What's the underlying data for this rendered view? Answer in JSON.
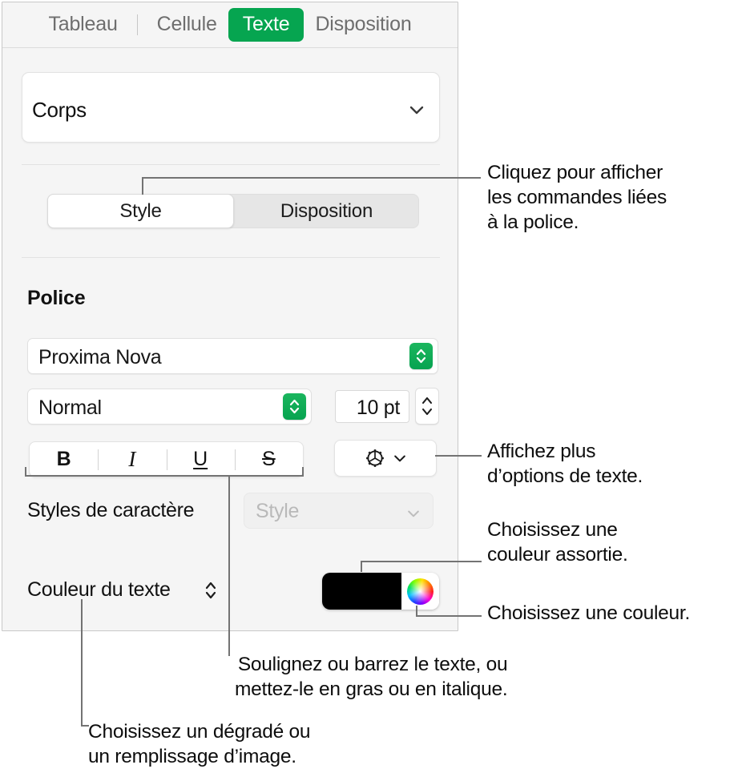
{
  "panel": {
    "tabs": [
      {
        "label": "Tableau",
        "active": false
      },
      {
        "label": "Cellule",
        "active": false
      },
      {
        "label": "Texte",
        "active": true
      },
      {
        "label": "Disposition",
        "active": false
      }
    ],
    "accent_color": "#06a550",
    "paragraph_style": {
      "value": "Corps",
      "chevron_icon": "chevron-down-icon"
    },
    "segmented": {
      "options": [
        "Style",
        "Disposition"
      ],
      "selected": "Style"
    },
    "font_section": {
      "heading": "Police",
      "family": "Proxima Nova",
      "weight": "Normal",
      "size": "10 pt",
      "stepper_icon": "up-down-chevron-icon"
    },
    "format_buttons": [
      {
        "name": "bold",
        "glyph": "B"
      },
      {
        "name": "italic",
        "glyph": "I"
      },
      {
        "name": "underline",
        "glyph": "U"
      },
      {
        "name": "strikethrough",
        "glyph": "S"
      }
    ],
    "gear_button": {
      "icon": "gear-icon",
      "chevron_icon": "chevron-down-icon"
    },
    "character_styles": {
      "label": "Styles de caractère",
      "placeholder": "Style",
      "value": "",
      "chevron_icon": "chevron-down-icon"
    },
    "text_color": {
      "label": "Couleur du texte",
      "popup_icon": "up-down-chevron-icon",
      "swatch_color": "#000000",
      "wheel_icon": "color-wheel-icon"
    }
  },
  "callouts": {
    "font_commands": "Cliquez pour afficher\nles commandes liées\nà la police.",
    "more_text_options": "Affichez plus\nd’options de texte.",
    "matching_color": "Choisissez une\ncouleur assortie.",
    "choose_color": "Choisissez une couleur.",
    "bius_help": "Soulignez ou barrez le texte, ou\nmettez-le en gras ou en italique.",
    "gradient_help": "Choisissez un dégradé ou\nun remplissage d’image."
  }
}
